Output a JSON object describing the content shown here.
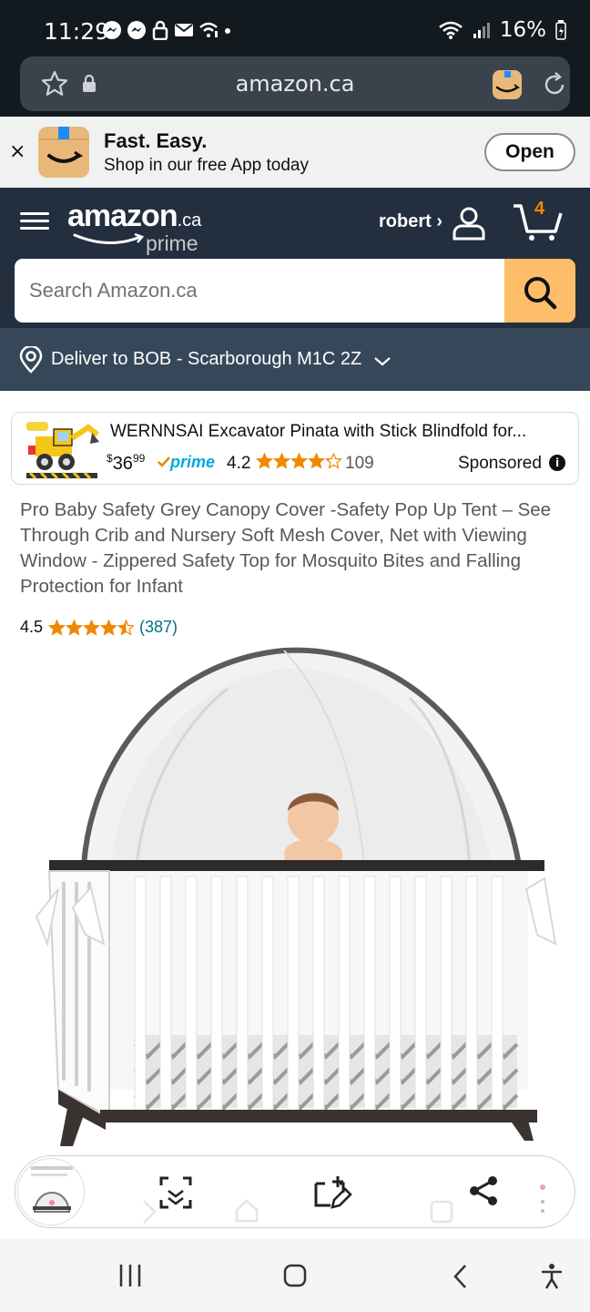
{
  "status_bar": {
    "time": "11:29",
    "battery": "16%",
    "icons": [
      "messenger-icon",
      "messenger-icon",
      "lock-icon",
      "mail-icon",
      "wifi-alert-icon",
      "dot-icon"
    ]
  },
  "browser": {
    "url": "amazon.ca"
  },
  "app_banner": {
    "title": "Fast. Easy.",
    "subtitle": "Shop in our free App today",
    "open_label": "Open",
    "close_label": "×"
  },
  "header": {
    "logo_text": "amazon",
    "logo_suffix": ".ca",
    "logo_sub": "prime",
    "user_label": "robert ›",
    "cart_count": "4"
  },
  "search": {
    "placeholder": "Search Amazon.ca"
  },
  "deliver": {
    "text": "Deliver to BOB - Scarborough M1C 2Z"
  },
  "sponsored_ad": {
    "title": "WERNNSAI Excavator Pinata with Stick Blindfold for...",
    "price_currency": "$",
    "price_whole": "36",
    "price_fraction": "99",
    "prime_label": "prime",
    "rating": "4.2",
    "rating_value": 4.2,
    "review_count": "109",
    "sponsored_label": "Sponsored",
    "info_label": "i"
  },
  "product": {
    "title": "Pro Baby Safety Grey Canopy Cover -Safety Pop Up Tent – See Through Crib and Nursery Soft Mesh Cover, Net with Viewing Window - Zippered Safety Top for Mosquito Bites and Falling Protection for Infant",
    "rating": "4.5",
    "rating_value": 4.5,
    "review_count": "(387)"
  },
  "floating_toolbar": {
    "tools": [
      "scan-icon",
      "edit-capture-icon",
      "share-icon"
    ]
  },
  "colors": {
    "status_bg": "#12191f",
    "header_bg": "#232f3e",
    "deliver_bg": "#37475a",
    "search_button": "#febd69",
    "star": "#f08804",
    "link": "#007185",
    "prime_blue": "#00a8e1"
  }
}
